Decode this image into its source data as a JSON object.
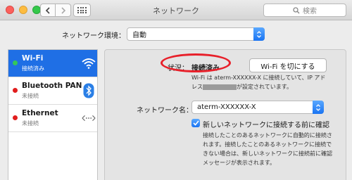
{
  "window": {
    "title": "ネットワーク"
  },
  "search": {
    "placeholder": "検索"
  },
  "location": {
    "label": "ネットワーク環境：",
    "value": "自動"
  },
  "services": [
    {
      "name": "Wi-Fi",
      "status": "接続済み",
      "dot_color": "#34c759",
      "icon": "wifi-icon",
      "selected": true
    },
    {
      "name": "Bluetooth PAN",
      "status": "未接続",
      "dot_color": "#e11d1d",
      "icon": "bluetooth-icon",
      "selected": false
    },
    {
      "name": "Ethernet",
      "status": "未接続",
      "dot_color": "#e11d1d",
      "icon": "ethernet-icon",
      "selected": false
    }
  ],
  "detail": {
    "status_label": "状況：",
    "status_value": "接続済み",
    "turn_off_button": "Wi-Fi を切にする",
    "description_line1": "Wi-Fi は aterm-XXXXXX-X に接続していて、IP アド",
    "description_line2_prefix": "レス",
    "description_line2_suffix": "が設定されています。",
    "network_name_label": "ネットワーク名：",
    "network_name_value": "aterm-XXXXXX-X",
    "ask_checkbox_label": "新しいネットワークに接続する前に確認",
    "help_text": "接続したことのあるネットワークに自動的に接続されます。接続したことのあるネットワークに接続できない場合は、新しいネットワークに接続前に確認メッセージが表示されます。"
  },
  "colors": {
    "accent": "#1f6fe5",
    "highlight_ring": "#e8202a"
  }
}
